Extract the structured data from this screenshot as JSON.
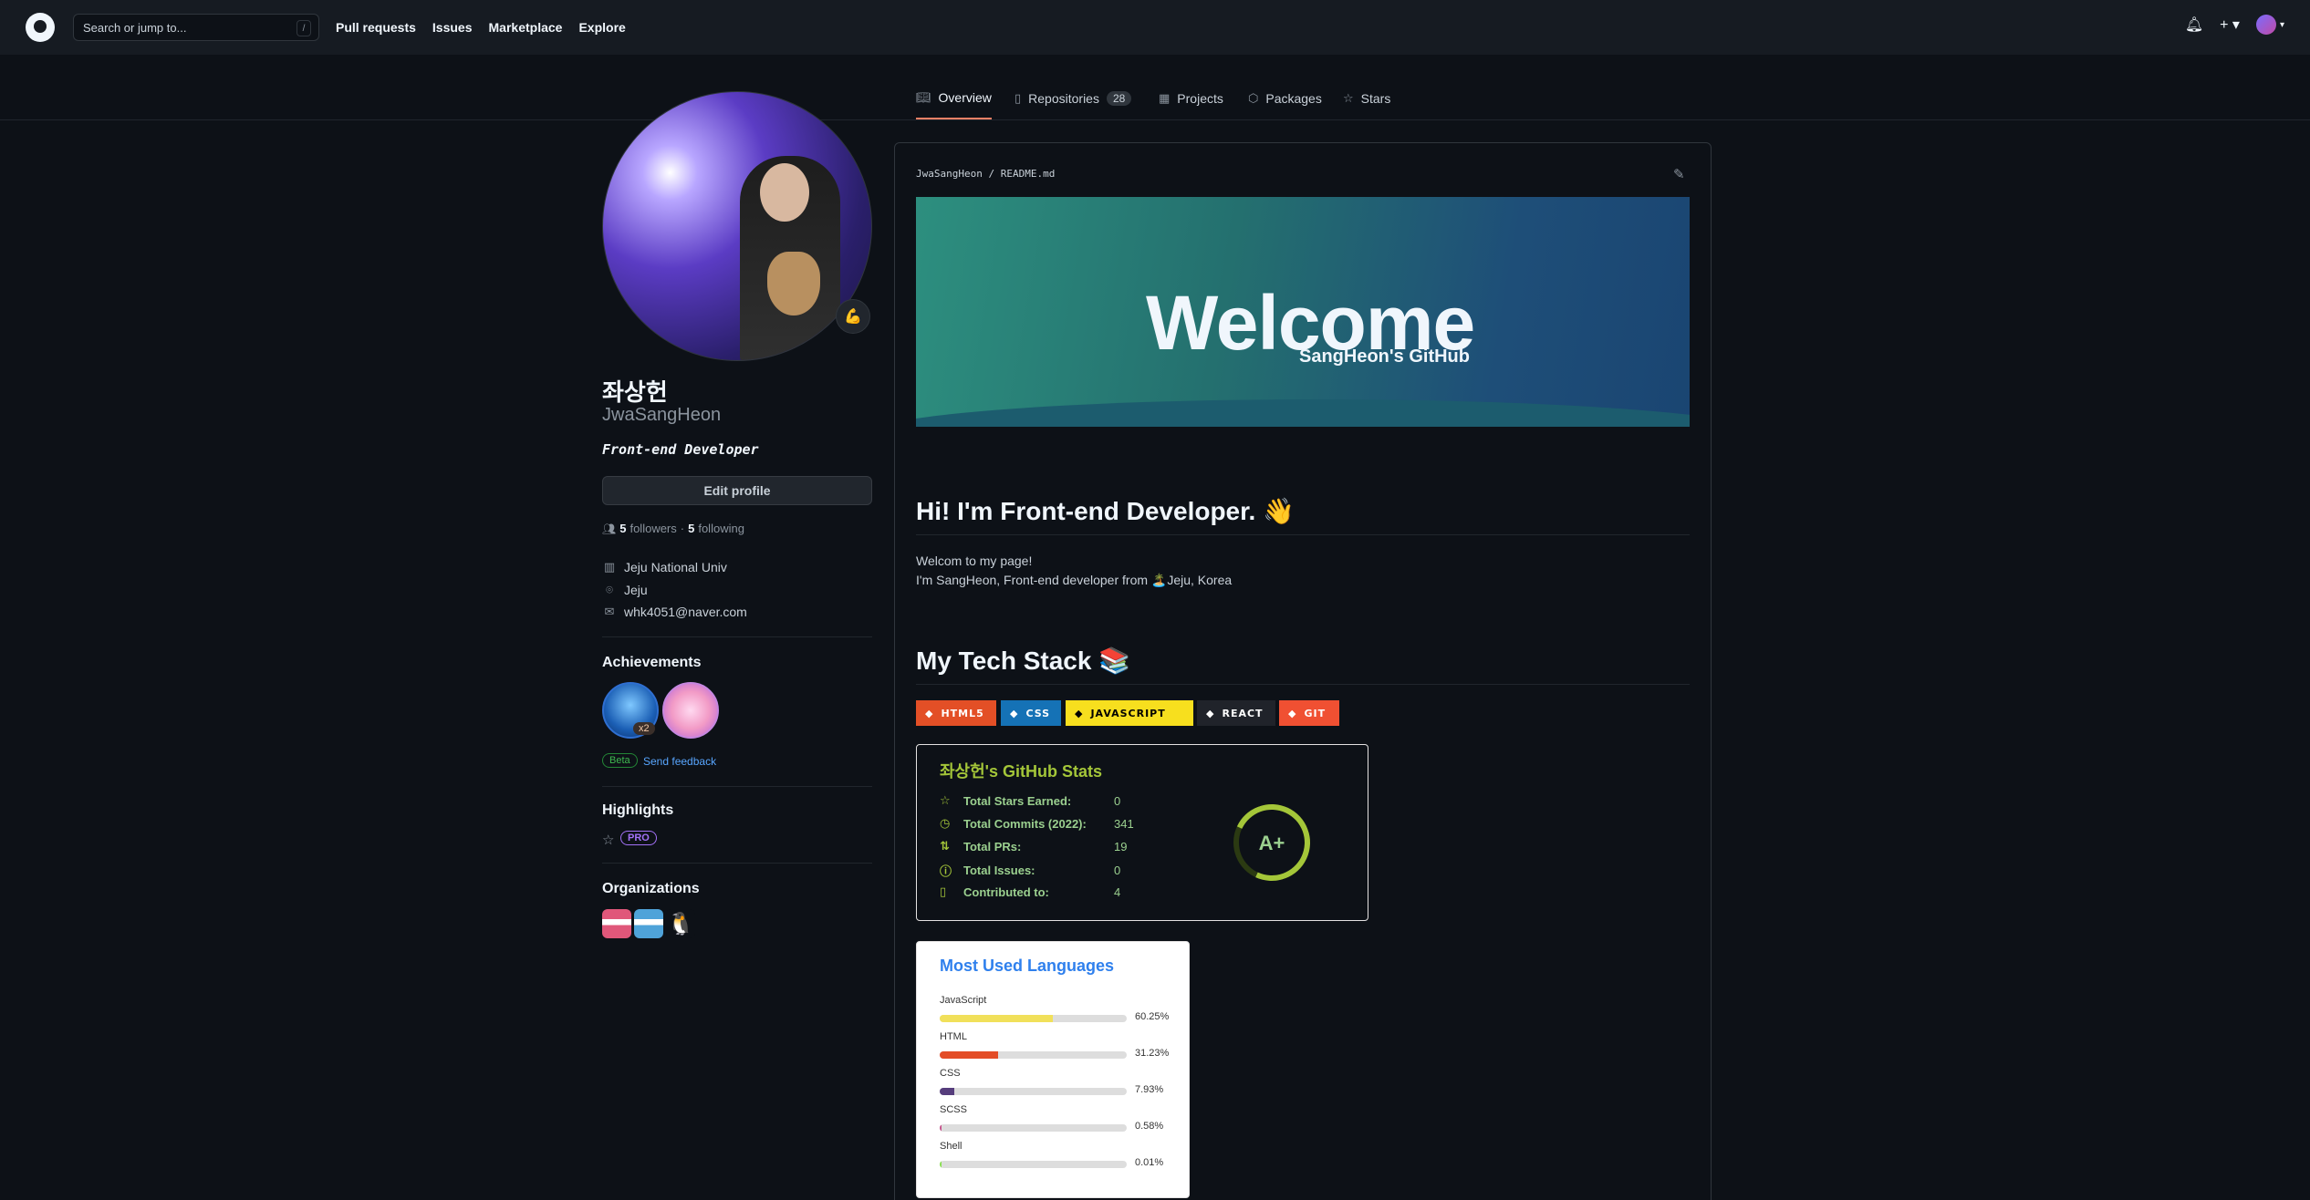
{
  "header": {
    "search_placeholder": "Search or jump to...",
    "search_shortcut": "/",
    "nav": [
      "Pull requests",
      "Issues",
      "Marketplace",
      "Explore"
    ]
  },
  "tabs": {
    "overview": "Overview",
    "repositories": "Repositories",
    "repositories_count": "28",
    "projects": "Projects",
    "packages": "Packages",
    "stars": "Stars"
  },
  "profile": {
    "status_emoji": "💪",
    "name": "좌상헌",
    "login": "JwaSangHeon",
    "bio": "Front-end Developer",
    "edit_button": "Edit profile",
    "followers_count": "5",
    "followers_label": "followers",
    "separator": "·",
    "following_count": "5",
    "following_label": "following",
    "organization": "Jeju National Univ",
    "location": "Jeju",
    "email": "whk4051@naver.com"
  },
  "sidebar": {
    "achievements_title": "Achievements",
    "achievement_multiplier": "x2",
    "beta_label": "Beta",
    "feedback_link": "Send feedback",
    "highlights_title": "Highlights",
    "pro_label": "PRO",
    "organizations_title": "Organizations"
  },
  "readme": {
    "path": "JwaSangHeon / README.md",
    "banner_title": "Welcome",
    "banner_subtitle": "SangHeon's GitHub",
    "heading1": "Hi! I'm Front-end Developer. 👋",
    "line1": "Welcom to my page!",
    "line2": "I'm SangHeon, Front-end developer from 🏝️Jeju, Korea",
    "heading2": "My Tech Stack 📚",
    "badges": [
      {
        "label": "HTML5",
        "color": "#e34f26",
        "text_color": "#ffffff"
      },
      {
        "label": "CSS",
        "color": "#1572b6",
        "text_color": "#ffffff"
      },
      {
        "label": "JAVASCRIPT",
        "color": "#f7df1e",
        "text_color": "#000000"
      },
      {
        "label": "REACT",
        "color": "#20232a",
        "text_color": "#ffffff"
      },
      {
        "label": "GIT",
        "color": "#f05032",
        "text_color": "#ffffff"
      }
    ]
  },
  "stats": {
    "title": "좌상헌's GitHub Stats",
    "rows": [
      {
        "label": "Total Stars Earned:",
        "value": "0",
        "icon": "star-icon"
      },
      {
        "label": "Total Commits (2022):",
        "value": "341",
        "icon": "history-icon"
      },
      {
        "label": "Total PRs:",
        "value": "19",
        "icon": "pull-request-icon"
      },
      {
        "label": "Total Issues:",
        "value": "0",
        "icon": "issue-icon"
      },
      {
        "label": "Contributed to:",
        "value": "4",
        "icon": "repo-icon"
      }
    ],
    "grade": "A+",
    "accent": "#a4c639"
  },
  "languages": {
    "title": "Most Used Languages",
    "items": [
      {
        "name": "JavaScript",
        "percent": "60.25%",
        "value": 60.25,
        "color": "#f1e05a"
      },
      {
        "name": "HTML",
        "percent": "31.23%",
        "value": 31.23,
        "color": "#e34c26"
      },
      {
        "name": "CSS",
        "percent": "7.93%",
        "value": 7.93,
        "color": "#563d7c"
      },
      {
        "name": "SCSS",
        "percent": "0.58%",
        "value": 0.58,
        "color": "#c6538c"
      },
      {
        "name": "Shell",
        "percent": "0.01%",
        "value": 0.01,
        "color": "#89e051"
      }
    ]
  }
}
